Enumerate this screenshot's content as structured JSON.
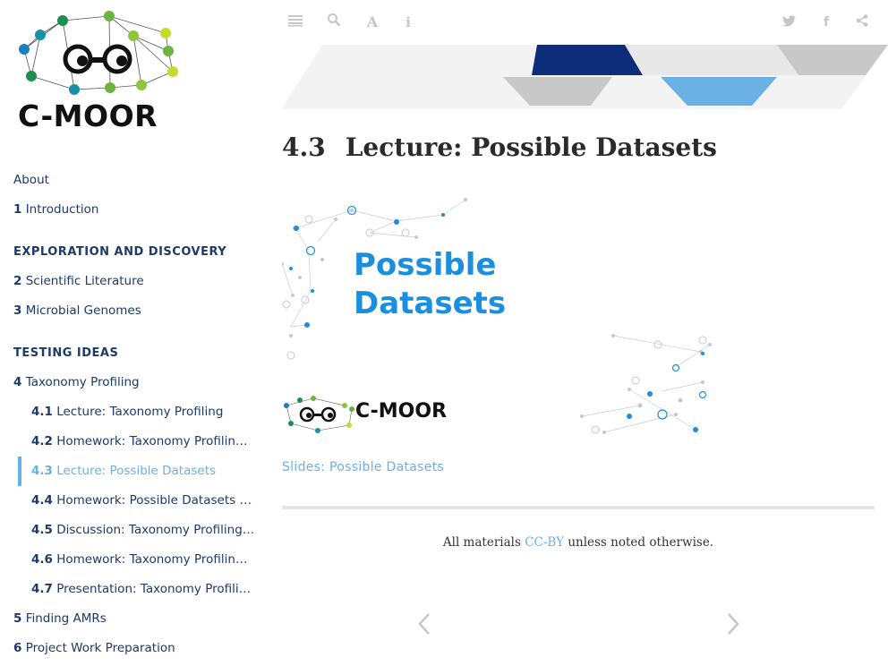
{
  "logo": {
    "text": "C-MOOR"
  },
  "sidebar": {
    "about": "About",
    "intro": {
      "num": "1",
      "label": "Introduction"
    },
    "section1": "EXPLORATION AND DISCOVERY",
    "ch2": {
      "num": "2",
      "label": "Scientific Literature"
    },
    "ch3": {
      "num": "3",
      "label": "Microbial Genomes"
    },
    "section2": "TESTING IDEAS",
    "ch4": {
      "num": "4",
      "label": "Taxonomy Profiling"
    },
    "sub": [
      {
        "num": "4.1",
        "label": "Lecture: Taxonomy Profiling"
      },
      {
        "num": "4.2",
        "label": "Homework: Taxonomy Profiling Pr…"
      },
      {
        "num": "4.3",
        "label": "Lecture: Possible Datasets"
      },
      {
        "num": "4.4",
        "label": "Homework: Possible Datasets Act…"
      },
      {
        "num": "4.5",
        "label": "Discussion: Taxonomy Profiling P…"
      },
      {
        "num": "4.6",
        "label": "Homework: Taxonomy Profiling P…"
      },
      {
        "num": "4.7",
        "label": "Presentation: Taxonomy Profiling …"
      }
    ],
    "ch5": {
      "num": "5",
      "label": "Finding AMRs"
    },
    "ch6": {
      "num": "6",
      "label": "Project Work Preparation"
    },
    "active_index": 2
  },
  "toolbar": {
    "icons": [
      "menu-icon",
      "search-icon",
      "font-icon",
      "info-icon",
      "twitter-icon",
      "facebook-icon",
      "share-icon"
    ]
  },
  "main": {
    "title_num": "4.3",
    "title": "Lecture: Possible Datasets",
    "slide": {
      "title_line1": "Possible",
      "title_line2": "Datasets",
      "logo_text": "C-MOOR"
    },
    "slides_link": "Slides: Possible Datasets",
    "footer_prefix": "All materials",
    "footer_link": "CC-BY",
    "footer_suffix": "unless noted otherwise."
  },
  "colors": {
    "nav_text": "#1d3a68",
    "accent": "#6ab0e4",
    "slide_blue": "#1a8fe0",
    "banner_dark": "#0d2d7a",
    "banner_light": "#6ab0e4"
  }
}
